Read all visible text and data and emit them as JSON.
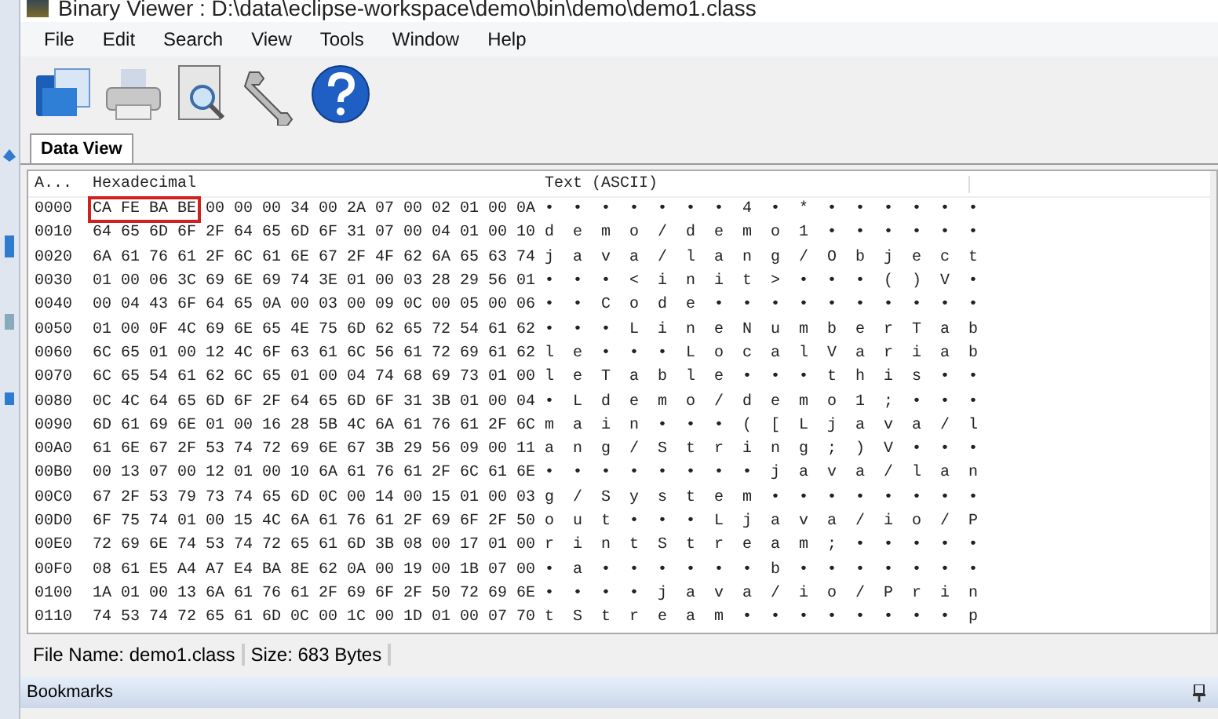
{
  "window": {
    "title": "Binary Viewer : D:\\data\\eclipse-workspace\\demo\\bin\\demo\\demo1.class"
  },
  "menu": [
    "File",
    "Edit",
    "Search",
    "View",
    "Tools",
    "Window",
    "Help"
  ],
  "toolbar": [
    {
      "kind": "open"
    },
    {
      "kind": "print"
    },
    {
      "kind": "preview"
    },
    {
      "kind": "settings"
    },
    {
      "kind": "help"
    }
  ],
  "tabs": [
    {
      "label": "Data View",
      "selected": true
    }
  ],
  "table": {
    "columns": [
      "A...",
      "Hexadecimal",
      "Text (ASCII)"
    ],
    "rows": [
      {
        "address": "0000",
        "hex_boxed": "CA FE BA BE",
        "hex": "00 00 00 34 00 2A 07 00 02 01 00 0A",
        "text": "• • • • • • • 4 • * • • • • • •"
      },
      {
        "address": "0010",
        "hex": "64 65 6D 6F 2F 64 65 6D 6F 31 07 00 04 01 00 10",
        "text": "d e m o / d e m o 1 • • • • • •"
      },
      {
        "address": "0020",
        "hex": "6A 61 76 61 2F 6C 61 6E 67 2F 4F 62 6A 65 63 74",
        "text": "j a v a / l a n g / O b j e c t"
      },
      {
        "address": "0030",
        "hex": "01 00 06 3C 69 6E 69 74 3E 01 00 03 28 29 56 01",
        "text": "• • • < i n i t > • • • ( ) V •"
      },
      {
        "address": "0040",
        "hex": "00 04 43 6F 64 65 0A 00 03 00 09 0C 00 05 00 06",
        "text": "• • C o d e • • • • • • • • • •"
      },
      {
        "address": "0050",
        "hex": "01 00 0F 4C 69 6E 65 4E 75 6D 62 65 72 54 61 62",
        "text": "• • • L i n e N u m b e r T a b"
      },
      {
        "address": "0060",
        "hex": "6C 65 01 00 12 4C 6F 63 61 6C 56 61 72 69 61 62",
        "text": "l e • • • L o c a l V a r i a b"
      },
      {
        "address": "0070",
        "hex": "6C 65 54 61 62 6C 65 01 00 04 74 68 69 73 01 00",
        "text": "l e T a b l e • • • t h i s • •"
      },
      {
        "address": "0080",
        "hex": "0C 4C 64 65 6D 6F 2F 64 65 6D 6F 31 3B 01 00 04",
        "text": "• L d e m o / d e m o 1 ; • • •"
      },
      {
        "address": "0090",
        "hex": "6D 61 69 6E 01 00 16 28 5B 4C 6A 61 76 61 2F 6C",
        "text": "m a i n • • • ( [ L j a v a / l"
      },
      {
        "address": "00A0",
        "hex": "61 6E 67 2F 53 74 72 69 6E 67 3B 29 56 09 00 11",
        "text": "a n g / S t r i n g ; ) V • • •"
      },
      {
        "address": "00B0",
        "hex": "00 13 07 00 12 01 00 10 6A 61 76 61 2F 6C 61 6E",
        "text": "• • • • • • • • j a v a / l a n"
      },
      {
        "address": "00C0",
        "hex": "67 2F 53 79 73 74 65 6D 0C 00 14 00 15 01 00 03",
        "text": "g / S y s t e m • • • • • • • •"
      },
      {
        "address": "00D0",
        "hex": "6F 75 74 01 00 15 4C 6A 61 76 61 2F 69 6F 2F 50",
        "text": "o u t • • • L j a v a / i o / P"
      },
      {
        "address": "00E0",
        "hex": "72 69 6E 74 53 74 72 65 61 6D 3B 08 00 17 01 00",
        "text": "r i n t S t r e a m ; • • • • •"
      },
      {
        "address": "00F0",
        "hex": "08 61 E5 A4 A7 E4 BA 8E 62 0A 00 19 00 1B 07 00",
        "text": "• a • • • • • • b • • • • • • •"
      },
      {
        "address": "0100",
        "hex": "1A 01 00 13 6A 61 76 61 2F 69 6F 2F 50 72 69 6E",
        "text": "• • • • j a v a / i o / P r i n"
      },
      {
        "address": "0110",
        "hex": "74 53 74 72 65 61 6D 0C 00 1C 00 1D 01 00 07 70",
        "text": "t S t r e a m • • • • • • • • p"
      }
    ]
  },
  "status_bar": [
    "File Name: demo1.class",
    "Size: 683 Bytes"
  ],
  "bookmarks": {
    "title": "Bookmarks"
  }
}
